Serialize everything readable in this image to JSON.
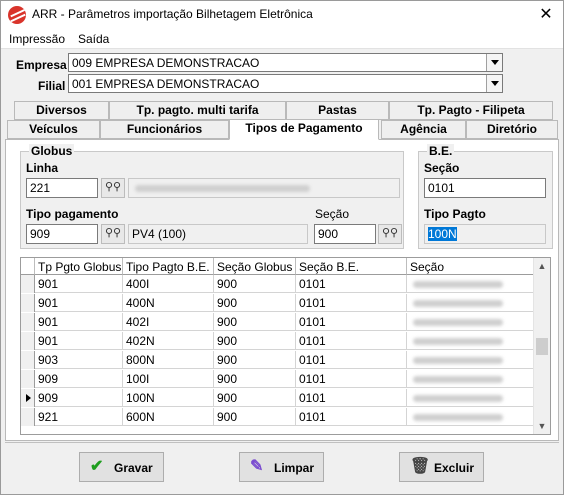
{
  "window": {
    "title": "ARR - Parâmetros importação Bilhetagem Eletrônica"
  },
  "menu": {
    "items": [
      "Impressão",
      "Saída"
    ]
  },
  "empresa": {
    "label": "Empresa",
    "value": "009 EMPRESA DEMONSTRACAO"
  },
  "filial": {
    "label": "Filial",
    "value": "001 EMPRESA DEMONSTRACAO"
  },
  "tabs": {
    "row1": [
      "Diversos",
      "Tp. pagto. multi tarifa",
      "Pastas",
      "Tp. Pagto - Filipeta"
    ],
    "row2": [
      "Veículos",
      "Funcionários",
      "Tipos de Pagamento",
      "Agência",
      "Diretório"
    ],
    "active": "Tipos de Pagamento"
  },
  "globus": {
    "title": "Globus",
    "linha_label": "Linha",
    "linha_value": "221",
    "tipo_pagamento_label": "Tipo pagamento",
    "tipo_pagamento_value": "909",
    "tipo_pagamento_desc": "PV4 (100)",
    "secao_label": "Seção",
    "secao_value": "900"
  },
  "be": {
    "title": "B.E.",
    "secao_label": "Seção",
    "secao_value": "0101",
    "tipo_pagto_label": "Tipo Pagto",
    "tipo_pagto_value": "100N"
  },
  "grid": {
    "columns": [
      "Tp Pgto Globus",
      "Tipo Pagto B.E.",
      "Seção Globus",
      "Seção B.E.",
      "Seção"
    ],
    "rows": [
      [
        "901",
        "400I",
        "900",
        "0101"
      ],
      [
        "901",
        "400N",
        "900",
        "0101"
      ],
      [
        "901",
        "402I",
        "900",
        "0101"
      ],
      [
        "901",
        "402N",
        "900",
        "0101"
      ],
      [
        "903",
        "800N",
        "900",
        "0101"
      ],
      [
        "909",
        "100I",
        "900",
        "0101"
      ],
      [
        "909",
        "100N",
        "900",
        "0101"
      ],
      [
        "921",
        "600N",
        "900",
        "0101"
      ]
    ],
    "current_row": 6
  },
  "buttons": {
    "save": "Gravar",
    "clear": "Limpar",
    "delete": "Excluir"
  },
  "colors": {
    "selection": "#0078d7",
    "save_icon": "#1e9e1e"
  }
}
